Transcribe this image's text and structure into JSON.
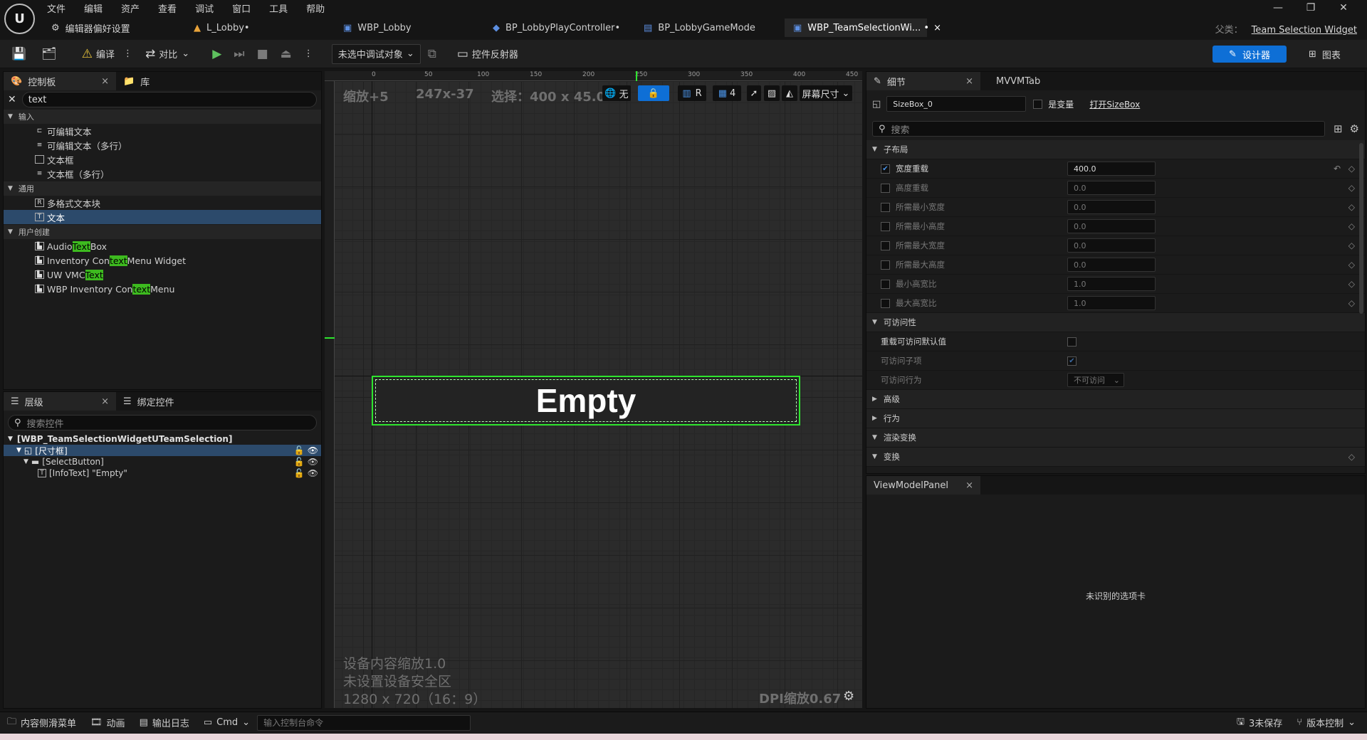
{
  "app": {
    "menu": [
      "文件",
      "编辑",
      "资产",
      "查看",
      "调试",
      "窗口",
      "工具",
      "帮助"
    ],
    "tabs": [
      {
        "label": "编辑器偏好设置",
        "icon": "sliders-icon"
      },
      {
        "label": "L_Lobby•",
        "icon": "level-icon"
      },
      {
        "label": "WBP_Lobby",
        "icon": "widget-blueprint-icon"
      },
      {
        "label": "BP_LobbyPlayController•",
        "icon": "controller-icon"
      },
      {
        "label": "BP_LobbyGameMode",
        "icon": "blueprint-icon"
      },
      {
        "label": "WBP_TeamSelectionWi... •",
        "icon": "widget-blueprint-icon",
        "active": true
      }
    ],
    "parent_label": "父类：",
    "parent_value": "Team Selection Widget"
  },
  "toolbar": {
    "compile": "编译",
    "diff": "对比",
    "debug_select": "未选中调试对象",
    "reflector": "控件反射器",
    "designer": "设计器",
    "graph": "图表"
  },
  "palette": {
    "tab1": "控制板",
    "tab2": "库",
    "search_value": "text",
    "categories": [
      {
        "name": "输入",
        "items": [
          "可编辑文本",
          "可编辑文本（多行）",
          "文本框",
          "文本框（多行）"
        ]
      },
      {
        "name": "通用",
        "items": [
          "多格式文本块",
          "文本"
        ]
      },
      {
        "name": "用户创建",
        "items_hl": [
          {
            "pre": "Audio ",
            "hl": "Text",
            "post": " Box"
          },
          {
            "pre": "Inventory Con",
            "hl": "text",
            "post": " Menu Widget"
          },
          {
            "pre": "UW VMC",
            "hl": "Text",
            "post": ""
          },
          {
            "pre": "WBP Inventory Con",
            "hl": "text",
            "post": " Menu"
          }
        ]
      }
    ]
  },
  "hierarchy": {
    "tab1": "层级",
    "tab2": "绑定控件",
    "search_placeholder": "搜索控件",
    "root": "[WBP_TeamSelectionWidgetUTeamSelection]",
    "nodes": [
      "[尺寸框]",
      "[SelectButton]",
      "[InfoText] \"Empty\""
    ]
  },
  "canvas": {
    "zoom": "缩放+5",
    "coords": "247x-37",
    "selection": "选择：400 x 45.04",
    "no_label": "无",
    "r_label": "R",
    "grid_num": "4",
    "screen_size": "屏幕尺寸",
    "top_ticks": [
      "0",
      "50",
      "100",
      "150",
      "200",
      "250",
      "300",
      "350",
      "400",
      "450"
    ],
    "widget_text": "Empty",
    "footer1": "设备内容缩放1.0",
    "footer2": "未设置设备安全区",
    "footer3": "1280 x 720（16：9）",
    "dpi": "DPI缩放0.67"
  },
  "details": {
    "tab1": "细节",
    "tab2": "MVVMTab",
    "name_value": "SizeBox_0",
    "is_variable": "是变量",
    "open_link": "打开SizeBox",
    "search_placeholder": "搜索",
    "section_slot": "子布局",
    "props": [
      {
        "label": "宽度重载",
        "value": "400.0",
        "checked": true
      },
      {
        "label": "高度重载",
        "value": "0.0"
      },
      {
        "label": "所需最小宽度",
        "value": "0.0"
      },
      {
        "label": "所需最小高度",
        "value": "0.0"
      },
      {
        "label": "所需最大宽度",
        "value": "0.0"
      },
      {
        "label": "所需最大高度",
        "value": "0.0"
      },
      {
        "label": "最小高宽比",
        "value": "1.0"
      },
      {
        "label": "最大高宽比",
        "value": "1.0"
      }
    ],
    "section_access": "可访问性",
    "access_override": "重载可访问默认值",
    "access_children": "可访问子项",
    "access_behavior": "可访问行为",
    "access_behavior_value": "不可访问",
    "sections": [
      "高级",
      "行为",
      "渲染变换",
      "变换"
    ]
  },
  "viewmodel": {
    "tab": "ViewModelPanel",
    "message": "未识别的选项卡"
  },
  "status": {
    "content_drawer": "内容侧滑菜单",
    "anim": "动画",
    "output_log": "输出日志",
    "cmd": "Cmd",
    "cmd_placeholder": "输入控制台命令",
    "unsaved": "3未保存",
    "version_control": "版本控制"
  },
  "colors": {
    "accent": "#0e6fd6",
    "selection_green": "#2ee52e",
    "highlight": "#3dba1f"
  }
}
